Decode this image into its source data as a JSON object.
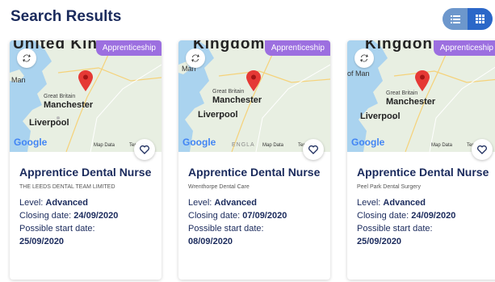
{
  "page": {
    "title": "Search Results"
  },
  "view_toggle": {
    "list_icon": "list-icon",
    "grid_icon": "grid-icon",
    "active": "grid"
  },
  "colors": {
    "primary": "#1a2a5c",
    "badge": "#9c6fe0",
    "pin": "#e53935",
    "toggle_active": "#2b67c8"
  },
  "cards": [
    {
      "badge": "Apprenticeship",
      "title": "Apprentice Dental Nurse",
      "employer": "THE LEEDS DENTAL TEAM LIMITED",
      "level_label": "Level:",
      "level": "Advanced",
      "closing_label": "Closing date:",
      "closing": "24/09/2020",
      "start_label": "Possible start date:",
      "start": "25/09/2020",
      "map": {
        "region": "United Kingdom",
        "island": "Man",
        "country": "Great Britain",
        "city": "Manchester",
        "city2": "Liverpool",
        "google": "Google",
        "map_data": "Map Data",
        "terms": "Terms"
      }
    },
    {
      "badge": "Apprenticeship",
      "title": "Apprentice Dental Nurse",
      "employer": "Wrenthorpe Dental Care",
      "level_label": "Level:",
      "level": "Advanced",
      "closing_label": "Closing date:",
      "closing": "07/09/2020",
      "start_label": "Possible start date:",
      "start": "08/09/2020",
      "map": {
        "region": "Kingdom",
        "island": "Man",
        "country": "Great Britain",
        "city": "Manchester",
        "city2": "Liverpool",
        "google": "Google",
        "extra": "ENGLA",
        "map_data": "Map Data",
        "terms": "Ter"
      }
    },
    {
      "badge": "Apprenticeship",
      "title": "Apprentice Dental Nurse",
      "employer": "Peel Park Dental Surgery",
      "level_label": "Level:",
      "level": "Advanced",
      "closing_label": "Closing date:",
      "closing": "24/09/2020",
      "start_label": "Possible start date:",
      "start": "25/09/2020",
      "map": {
        "region": "Kingdon",
        "island": "of Man",
        "country": "Great Britain",
        "city": "Manchester",
        "city2": "Liverpool",
        "google": "Google",
        "map_data": "Map Data",
        "terms": "Ter"
      }
    }
  ]
}
